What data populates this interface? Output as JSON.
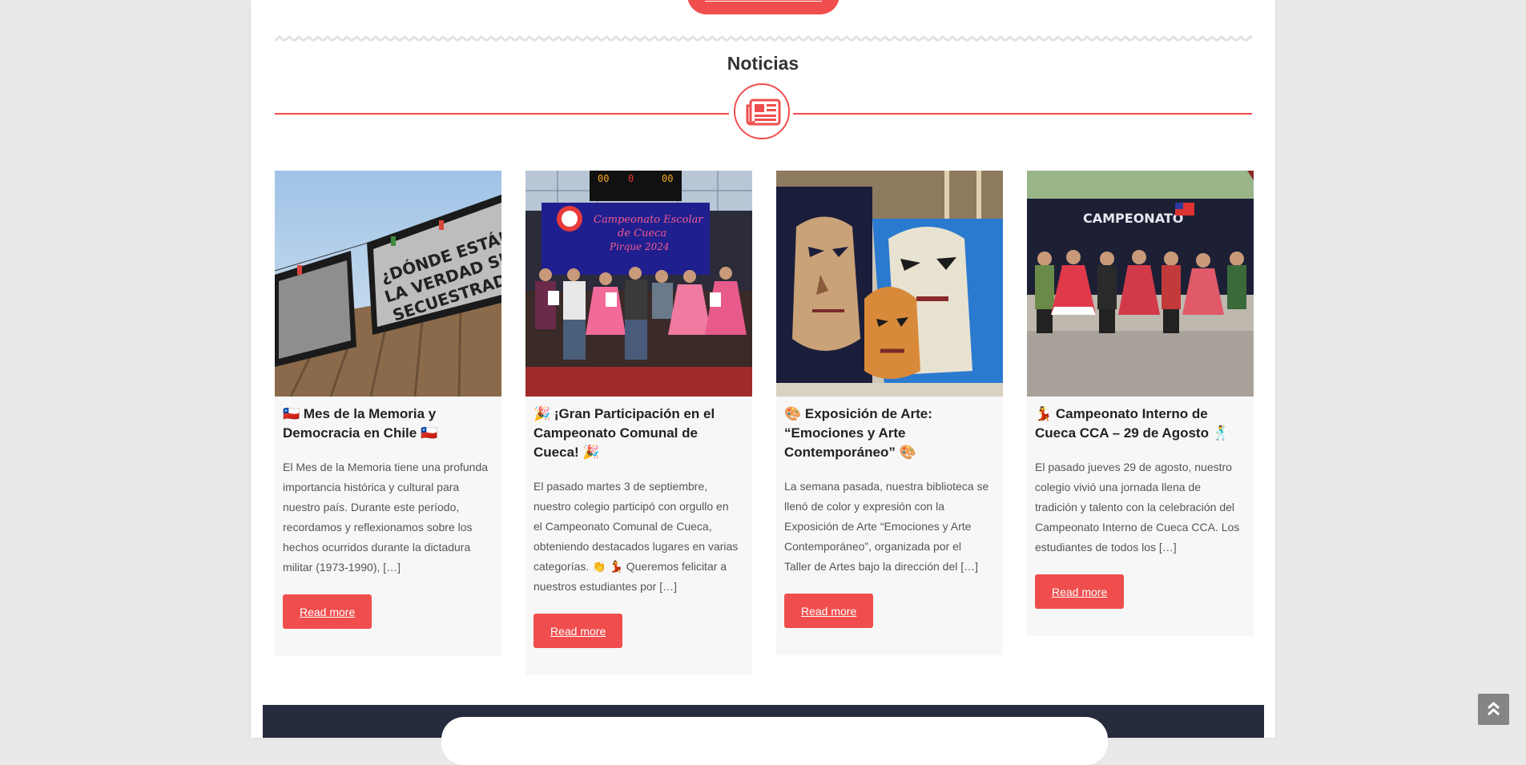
{
  "section": {
    "title": "Noticias",
    "icon": "newspaper-icon"
  },
  "colors": {
    "accent": "#f04e4e",
    "card_bg": "#f7f7f7",
    "footer_bg": "#262b3d",
    "page_bg": "#e9e9e9"
  },
  "cards": [
    {
      "title": "🇨🇱 Mes de la Memoria y Democracia en Chile 🇨🇱",
      "excerpt": "El Mes de la Memoria tiene una profunda importancia histórica y cultural para nuestro país. Durante este período, recordamos y reflexionamos sobre los hechos ocurridos durante la dictadura militar (1973-1990), […]",
      "button": "Read more",
      "image_text": "¿DÓNDE ESTÁN? LA VERDAD SIGUE SECUESTRADA"
    },
    {
      "title": "🎉 ¡Gran Participación en el Campeonato Comunal de Cueca! 🎉",
      "excerpt": "El pasado martes 3 de septiembre, nuestro colegio participó con orgullo en el Campeonato Comunal de Cueca, obteniendo destacados lugares en varias categorías. 👏 💃 Queremos felicitar a nuestros estudiantes por […]",
      "button": "Read more",
      "image_text": "Campeonato Escolar de Cueca Pirque 2024"
    },
    {
      "title": "🎨 Exposición de Arte: “Emociones y Arte Contemporáneo” 🎨",
      "excerpt": "La semana pasada, nuestra biblioteca se llenó de color y expresión con la Exposición de Arte “Emociones y Arte Contemporáneo”, organizada por el Taller de Artes bajo la dirección del […]",
      "button": "Read more",
      "image_text": ""
    },
    {
      "title": "💃 Campeonato Interno de Cueca CCA – 29 de Agosto 🕺",
      "excerpt": "El pasado jueves 29 de agosto, nuestro colegio vivió una jornada llena de tradición y talento con la celebración del Campeonato Interno de Cueca CCA. Los estudiantes de todos los […]",
      "button": "Read more",
      "image_text": "CAMPEONATO"
    }
  ],
  "scroll_top": {
    "icon": "double-chevron-up-icon"
  }
}
